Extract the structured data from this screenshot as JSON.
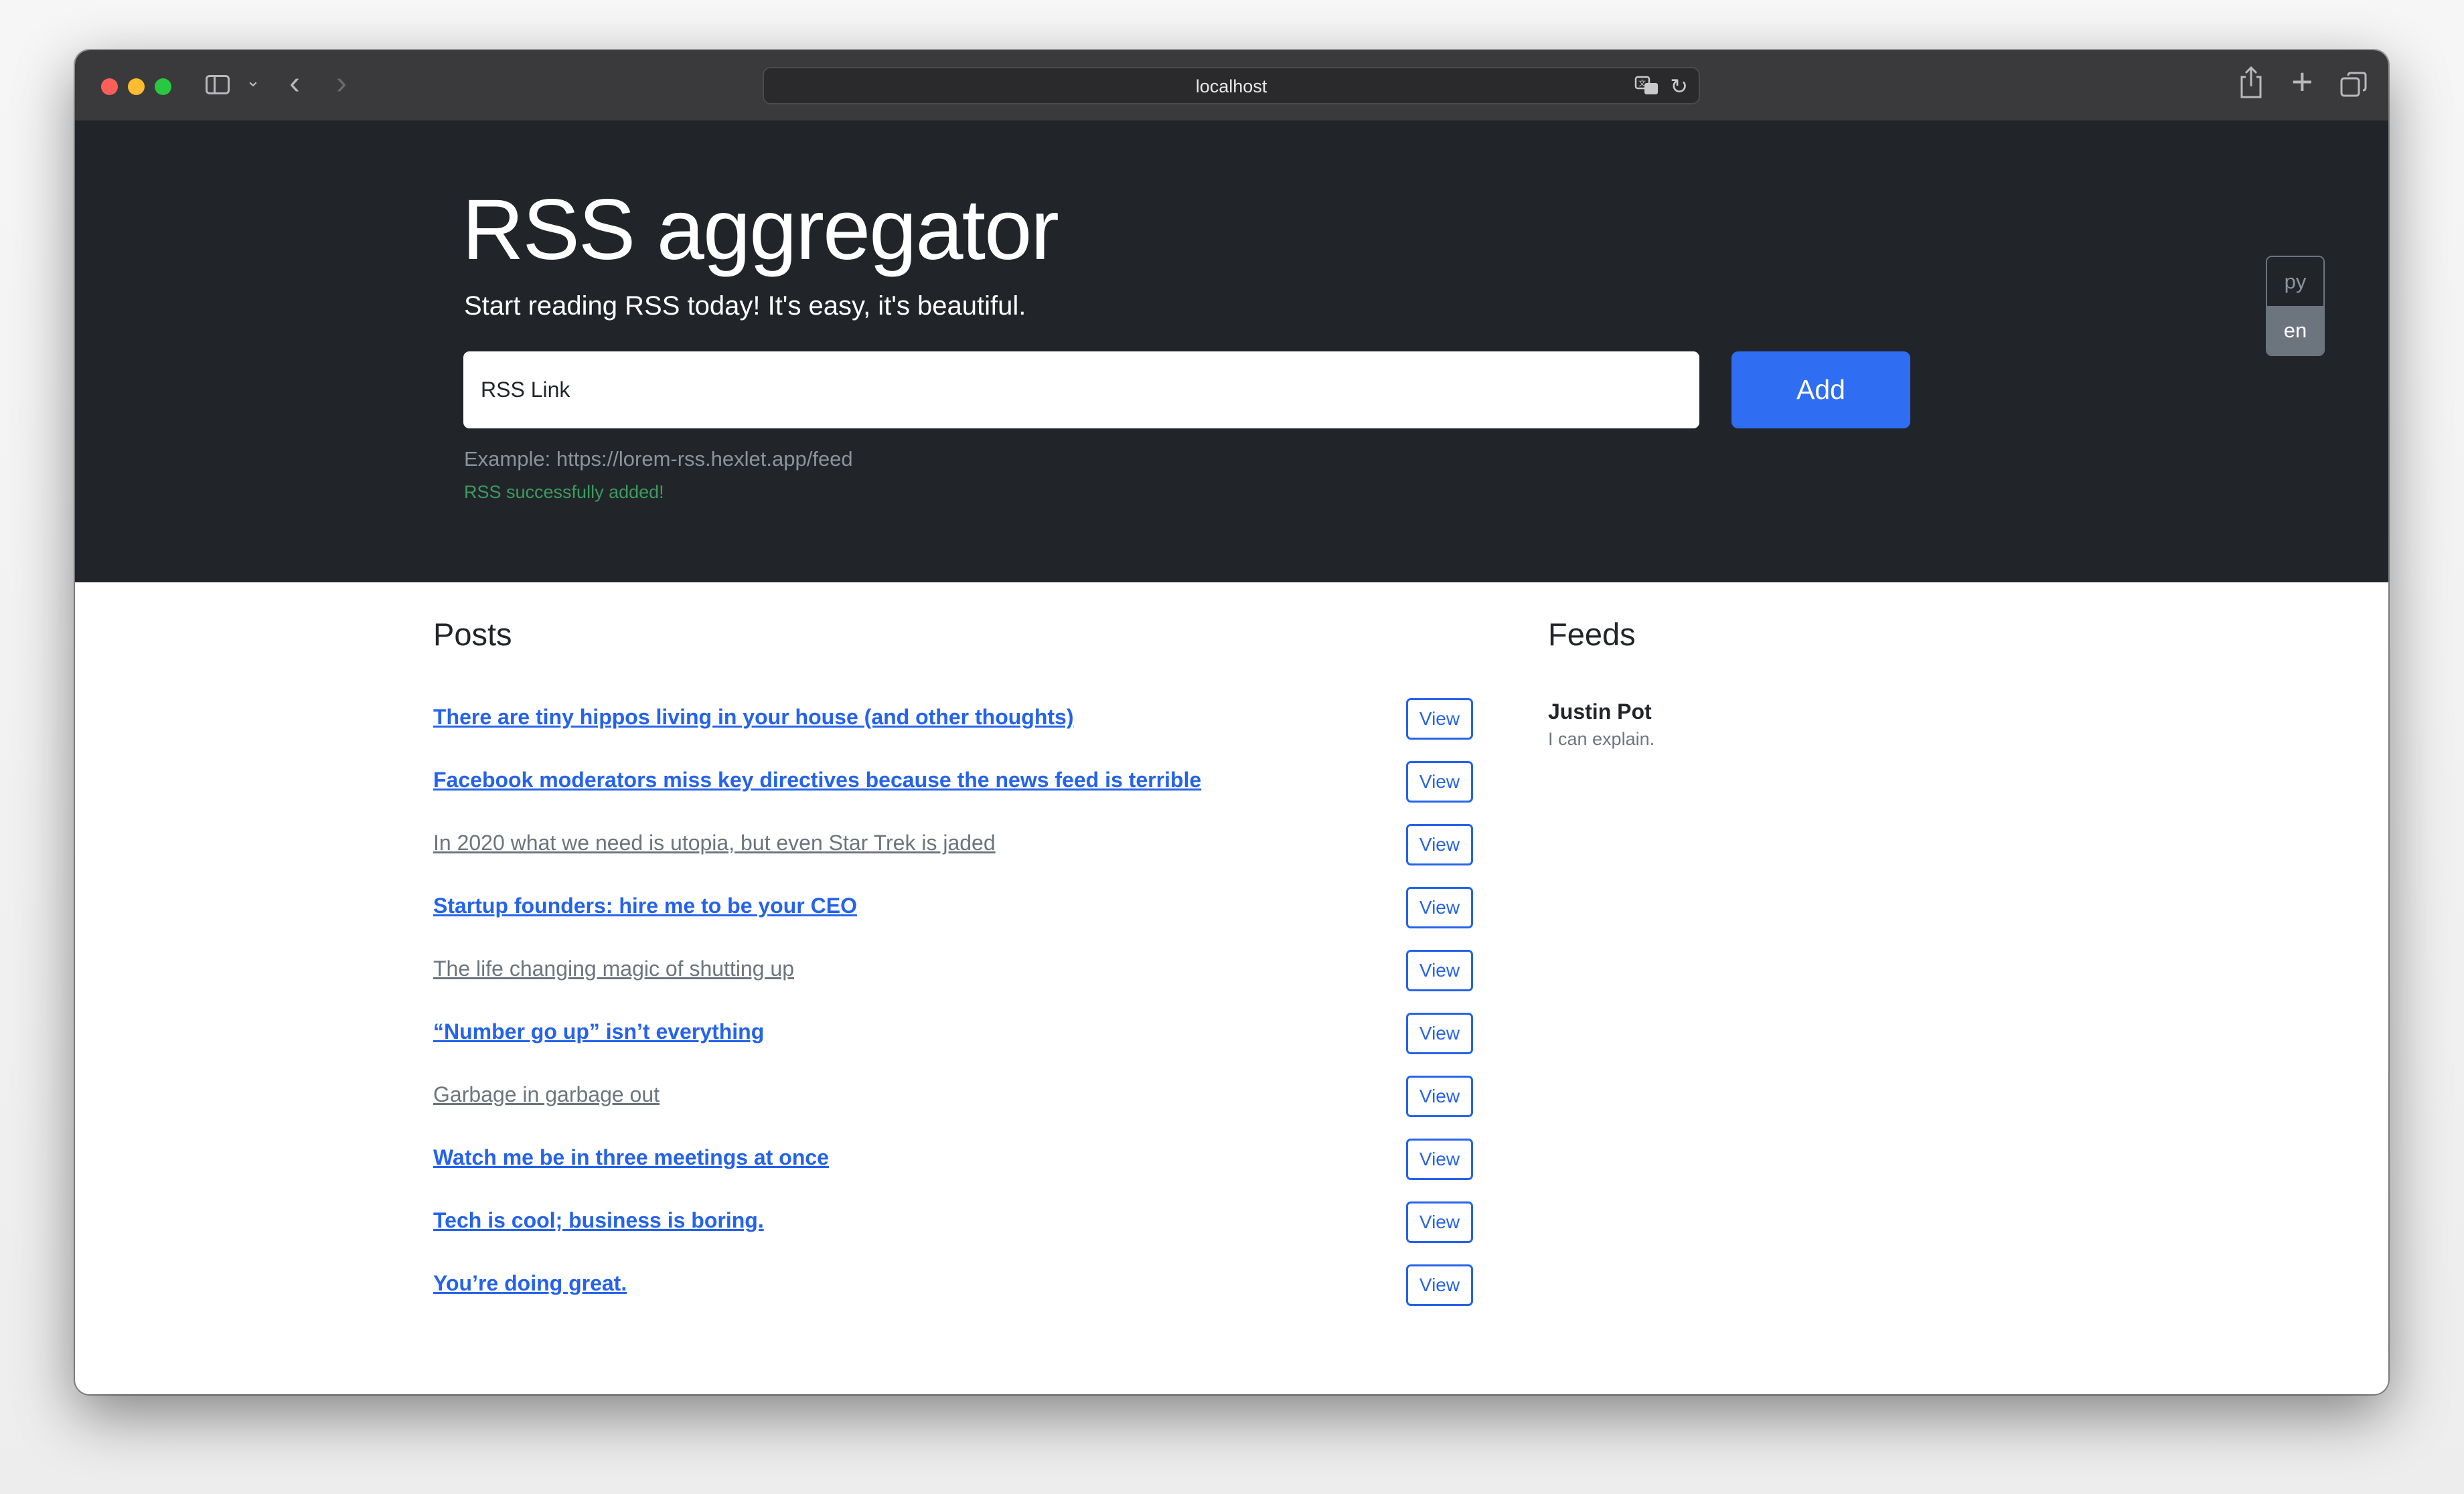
{
  "browser": {
    "url": "localhost"
  },
  "header": {
    "title": "RSS aggregator",
    "lead": "Start reading RSS today! It's easy, it's beautiful.",
    "input_value": "RSS Link",
    "add_label": "Add",
    "example": "Example: https://lorem-rss.hexlet.app/feed",
    "feedback": "RSS successfully added!"
  },
  "languages": {
    "ru": "py",
    "en": "en",
    "active": "en"
  },
  "posts": {
    "heading": "Posts",
    "view_label": "View",
    "items": [
      {
        "title": "There are tiny hippos living in your house (and other thoughts)",
        "read": false
      },
      {
        "title": "Facebook moderators miss key directives because the news feed is terrible",
        "read": false
      },
      {
        "title": "In 2020 what we need is utopia, but even Star Trek is jaded",
        "read": true
      },
      {
        "title": "Startup founders: hire me to be your CEO",
        "read": false
      },
      {
        "title": "The life changing magic of shutting up",
        "read": true
      },
      {
        "title": "“Number go up” isn’t everything",
        "read": false
      },
      {
        "title": "Garbage in garbage out",
        "read": true
      },
      {
        "title": "Watch me be in three meetings at once",
        "read": false
      },
      {
        "title": "Tech is cool; business is boring.",
        "read": false
      },
      {
        "title": "You’re doing great.",
        "read": false
      }
    ]
  },
  "feeds": {
    "heading": "Feeds",
    "items": [
      {
        "title": "Justin Pot",
        "description": "I can explain."
      }
    ]
  },
  "colors": {
    "hero_bg": "#212529",
    "primary": "#2f6ef2",
    "link_unread": "#2563eb",
    "link_read": "#6c757d",
    "success": "#3d9b5e"
  }
}
